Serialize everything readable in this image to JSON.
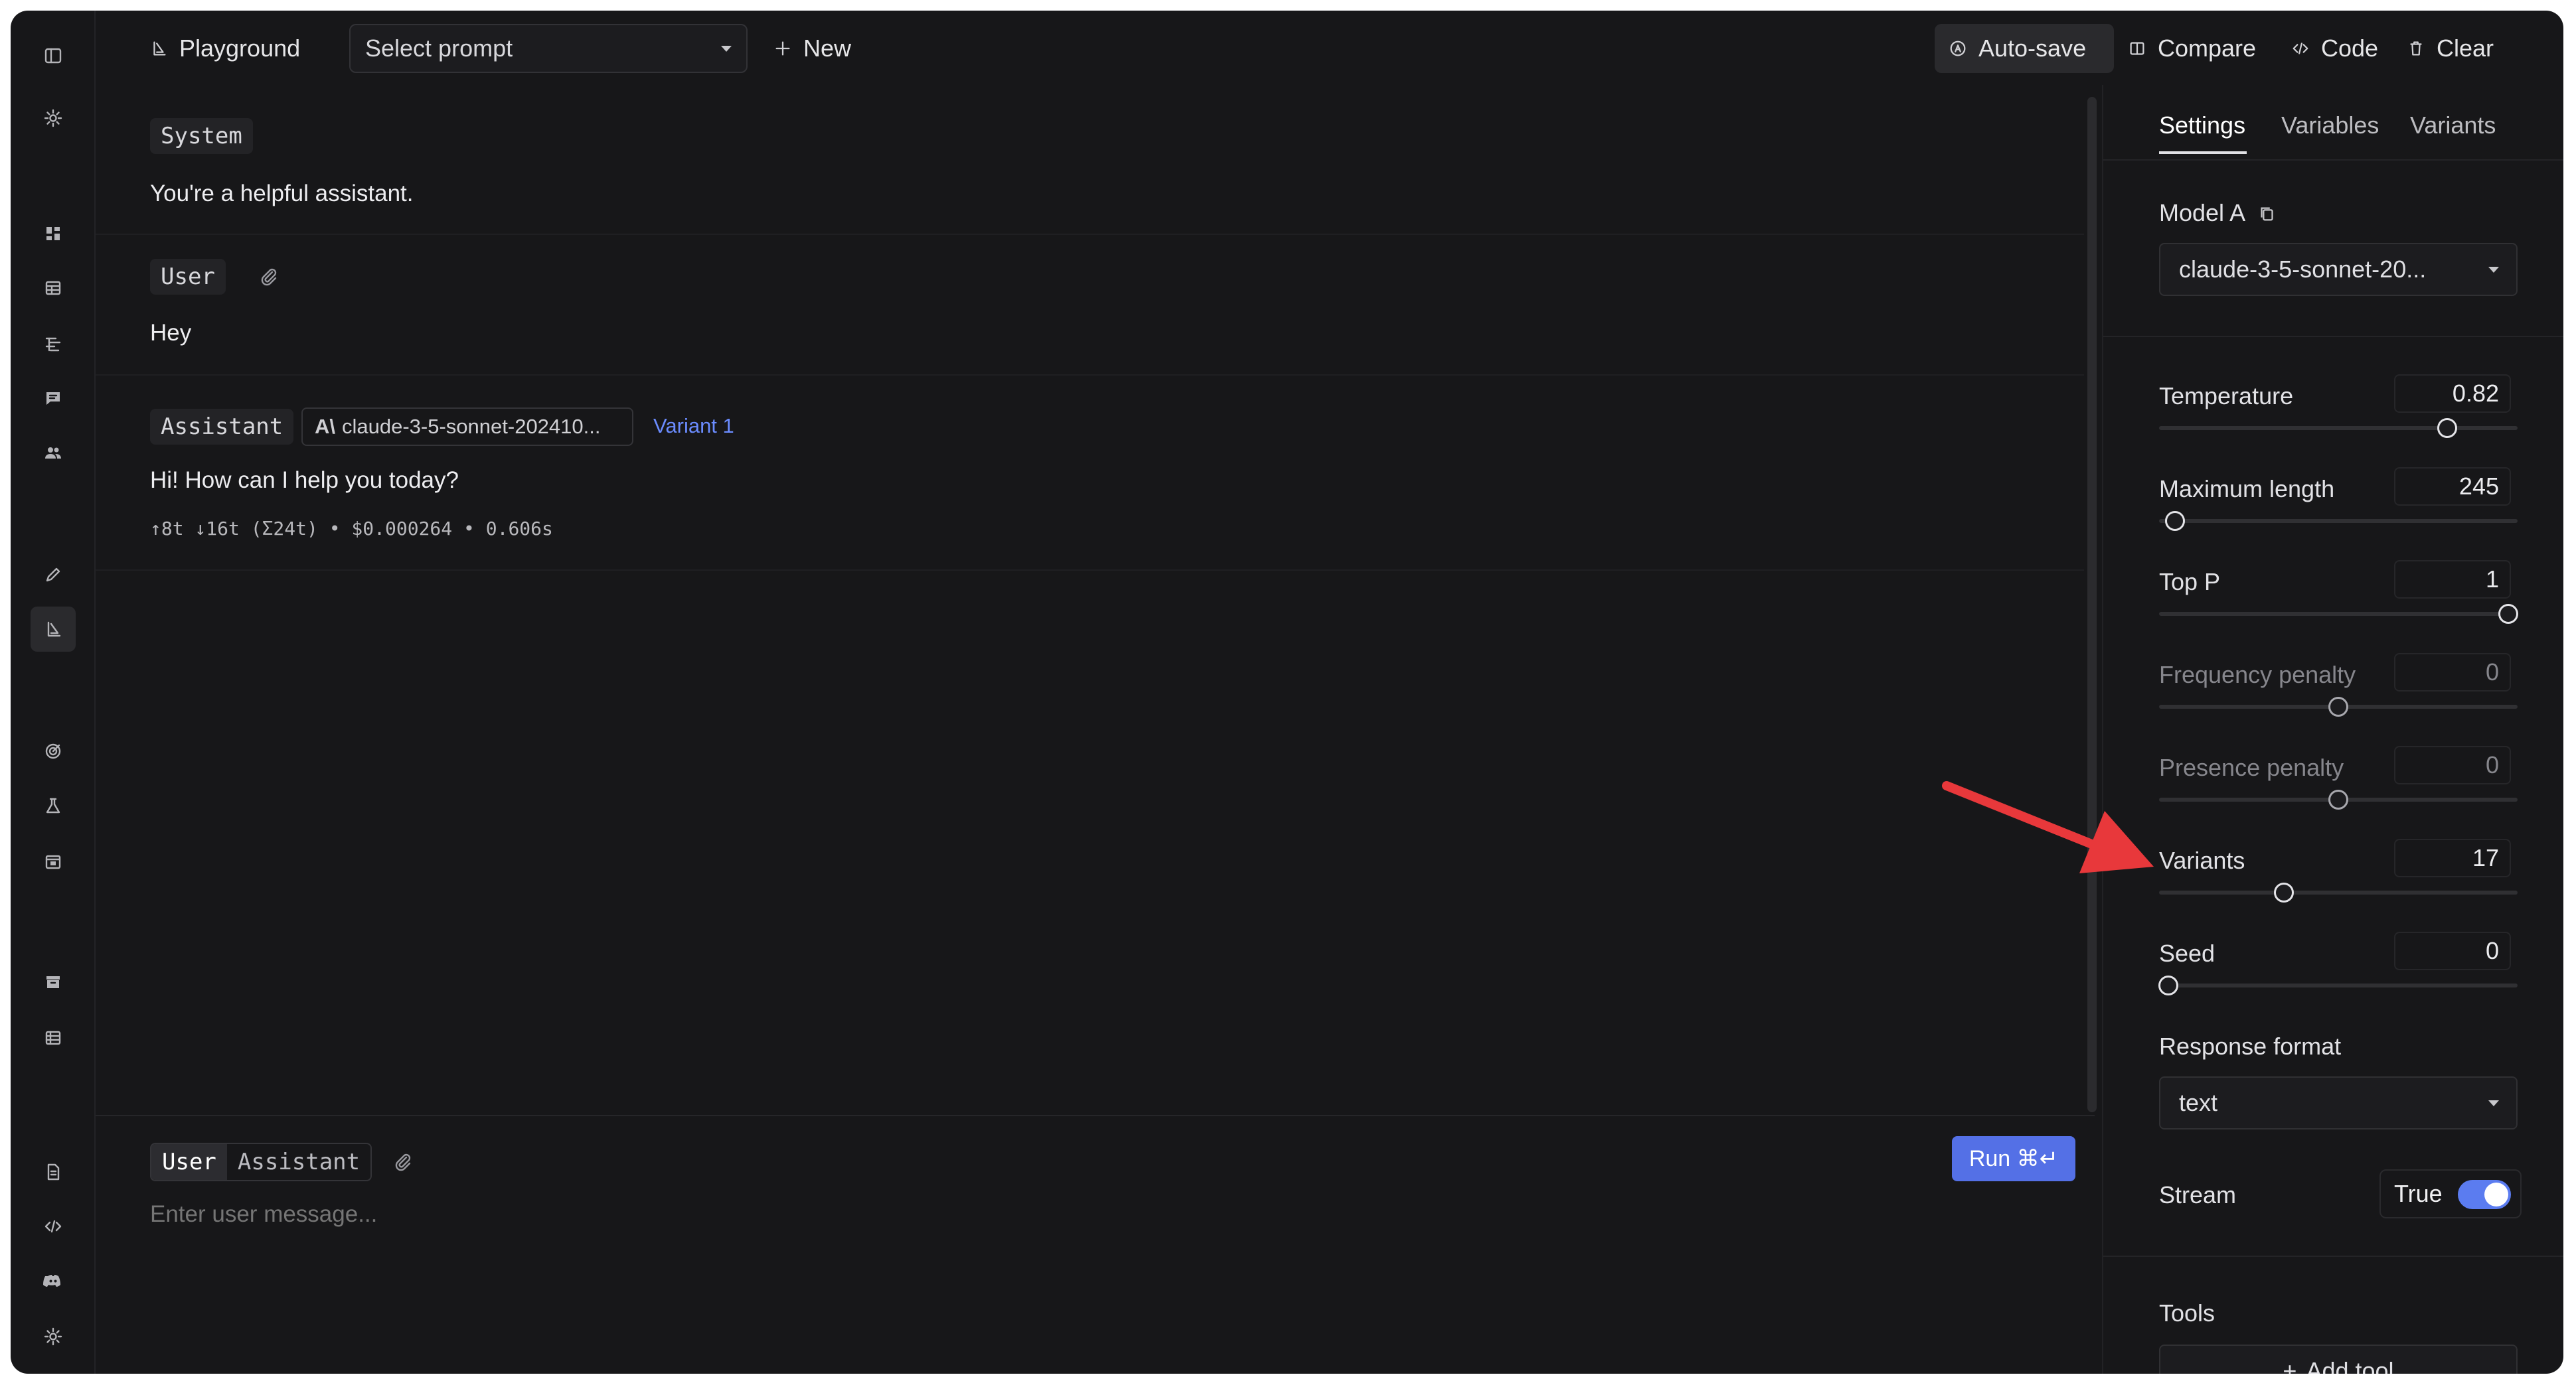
{
  "topbar": {
    "title": "Playground",
    "prompt_select": "Select prompt",
    "new_label": "New",
    "autosave_label": "Auto-save",
    "compare_label": "Compare",
    "code_label": "Code",
    "clear_label": "Clear"
  },
  "messages": {
    "system": {
      "role": "System",
      "text": "You're a helpful assistant."
    },
    "user": {
      "role": "User",
      "text": "Hey"
    },
    "assistant": {
      "role": "Assistant",
      "model": "claude-3-5-sonnet-202410...",
      "variant": "Variant 1",
      "text": "Hi! How can I help you today?",
      "usage": "↑8t ↓16t (Σ24t) • $0.000264 • 0.606s"
    }
  },
  "composer": {
    "role_user": "User",
    "role_assistant": "Assistant",
    "placeholder": "Enter user message...",
    "run_label": "Run ⌘↵"
  },
  "panel": {
    "tabs": [
      "Settings",
      "Variables",
      "Variants"
    ],
    "model_label": "Model A",
    "model_value": "claude-3-5-sonnet-20...",
    "params": [
      {
        "label": "Temperature",
        "value": "0.82",
        "level": 0.82,
        "disabled": false
      },
      {
        "label": "Maximum length",
        "value": "245",
        "level": 0.02,
        "disabled": false
      },
      {
        "label": "Top P",
        "value": "1",
        "level": 1.0,
        "disabled": false
      },
      {
        "label": "Frequency penalty",
        "value": "0",
        "level": 0.5,
        "disabled": true
      },
      {
        "label": "Presence penalty",
        "value": "0",
        "level": 0.5,
        "disabled": true
      },
      {
        "label": "Variants",
        "value": "17",
        "level": 0.34,
        "disabled": false
      },
      {
        "label": "Seed",
        "value": "0",
        "level": 0.0,
        "disabled": false
      }
    ],
    "response_format_label": "Response format",
    "response_format_value": "text",
    "stream_label": "Stream",
    "stream_value": "True",
    "tools_label": "Tools",
    "add_tool_label": "Add tool"
  },
  "colors": {
    "accent": "#5470e6",
    "arrow": "#e8383b",
    "background": "#171719"
  }
}
